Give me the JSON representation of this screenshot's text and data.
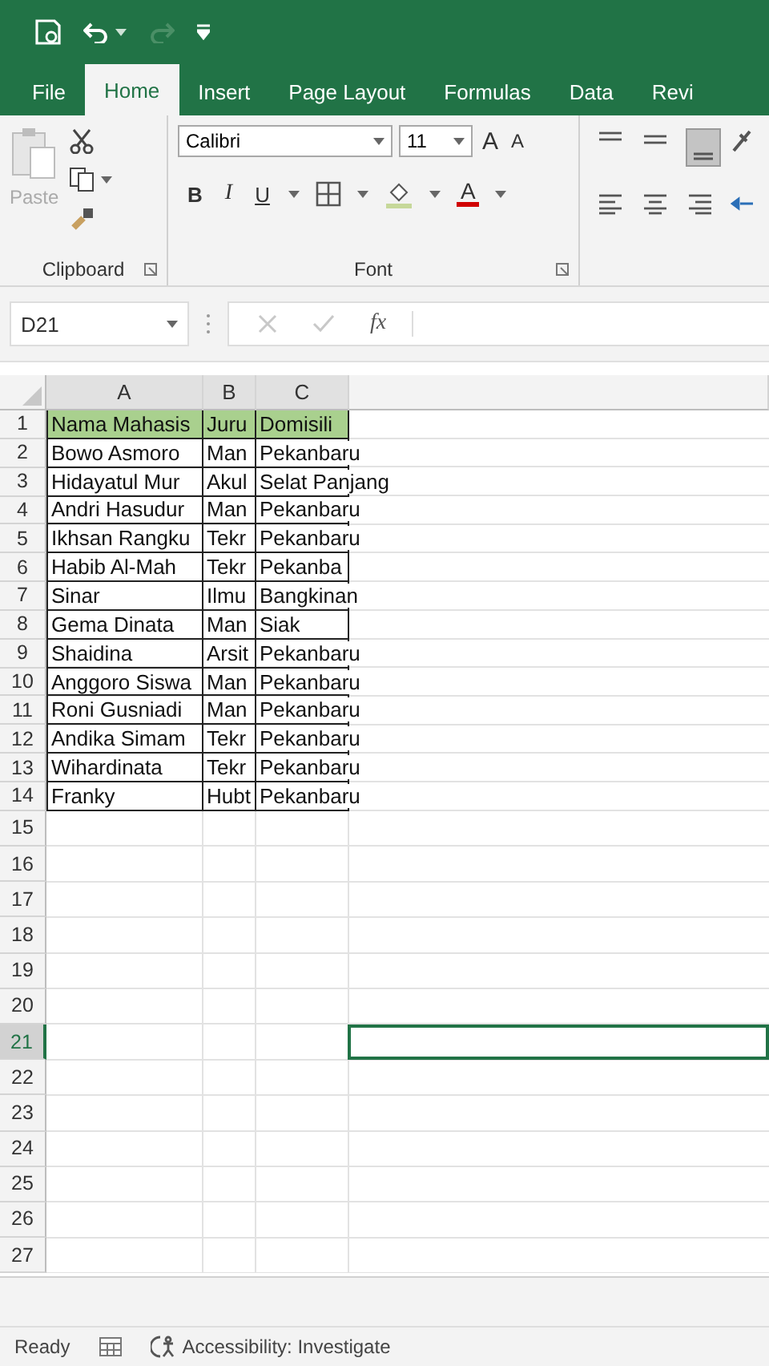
{
  "quick_access": [
    {
      "kind": "save",
      "disabled": false
    },
    {
      "kind": "undo",
      "disabled": false
    },
    {
      "kind": "redo",
      "disabled": true
    },
    {
      "kind": "customize",
      "disabled": false
    }
  ],
  "tabs": [
    {
      "label": "File",
      "selected": false
    },
    {
      "label": "Home",
      "selected": true
    },
    {
      "label": "Insert",
      "selected": false
    },
    {
      "label": "Page Layout",
      "selected": false
    },
    {
      "label": "Formulas",
      "selected": false
    },
    {
      "label": "Data",
      "selected": false
    },
    {
      "label": "Revi",
      "selected": false
    }
  ],
  "clipboard": {
    "paste_label": "Paste",
    "paste_disabled": true,
    "group_label": "Clipboard"
  },
  "font": {
    "name": "Calibri",
    "size": "11",
    "grow": "A",
    "shrink": "A",
    "bold": "B",
    "italic": "I",
    "underline": "U",
    "font_color": "A",
    "group_label": "Font"
  },
  "formula_bar": {
    "name_box": "D21",
    "function_label": "fx"
  },
  "sheet": {
    "columns": [
      {
        "label": "A"
      },
      {
        "label": "B"
      },
      {
        "label": "C"
      }
    ],
    "rows": [
      {
        "number": "1",
        "kind": "header",
        "cells": [
          "Nama Mahasis",
          "Juru",
          "Domisili"
        ]
      },
      {
        "number": "2",
        "kind": "data",
        "cells": [
          "Bowo Asmoro",
          "Man",
          "Pekanbaru"
        ]
      },
      {
        "number": "3",
        "kind": "data",
        "cells": [
          "Hidayatul Mur",
          "Akul",
          "Selat Panjang"
        ]
      },
      {
        "number": "4",
        "kind": "data",
        "cells": [
          "Andri Hasudur",
          "Man",
          "Pekanbaru"
        ]
      },
      {
        "number": "5",
        "kind": "data",
        "cells": [
          "Ikhsan Rangku",
          "Tekr",
          "Pekanbaru"
        ]
      },
      {
        "number": "6",
        "kind": "data",
        "cells": [
          "Habib Al-Mah",
          "Tekr",
          "Pekanba"
        ]
      },
      {
        "number": "7",
        "kind": "data",
        "cells": [
          "Sinar",
          "Ilmu",
          "Bangkinan"
        ]
      },
      {
        "number": "8",
        "kind": "data",
        "cells": [
          "Gema Dinata",
          "Man",
          "Siak"
        ]
      },
      {
        "number": "9",
        "kind": "data",
        "cells": [
          "Shaidina",
          "Arsit",
          "Pekanbaru"
        ]
      },
      {
        "number": "10",
        "kind": "data",
        "cells": [
          "Anggoro Siswa",
          "Man",
          "Pekanbaru"
        ]
      },
      {
        "number": "11",
        "kind": "data",
        "cells": [
          "Roni Gusniadi",
          "Man",
          "Pekanbaru"
        ]
      },
      {
        "number": "12",
        "kind": "data",
        "cells": [
          "Andika Simam",
          "Tekr",
          "Pekanbaru"
        ]
      },
      {
        "number": "13",
        "kind": "data",
        "cells": [
          "Wihardinata",
          "Tekr",
          "Pekanbaru"
        ]
      },
      {
        "number": "14",
        "kind": "data",
        "cells": [
          "Franky",
          "Hubt",
          "Pekanbaru"
        ]
      }
    ],
    "empty_rows": [
      {
        "number": "15",
        "selected": false
      },
      {
        "number": "16",
        "selected": false
      },
      {
        "number": "17",
        "selected": false
      },
      {
        "number": "18",
        "selected": false
      },
      {
        "number": "19",
        "selected": false
      },
      {
        "number": "20",
        "selected": false
      },
      {
        "number": "21",
        "selected": true
      },
      {
        "number": "22",
        "selected": false
      },
      {
        "number": "23",
        "selected": false
      },
      {
        "number": "24",
        "selected": false
      },
      {
        "number": "25",
        "selected": false
      },
      {
        "number": "26",
        "selected": false
      },
      {
        "number": "27",
        "selected": false
      }
    ]
  },
  "status_bar": {
    "mode": "Ready",
    "accessibility": "Accessibility: Investigate"
  }
}
